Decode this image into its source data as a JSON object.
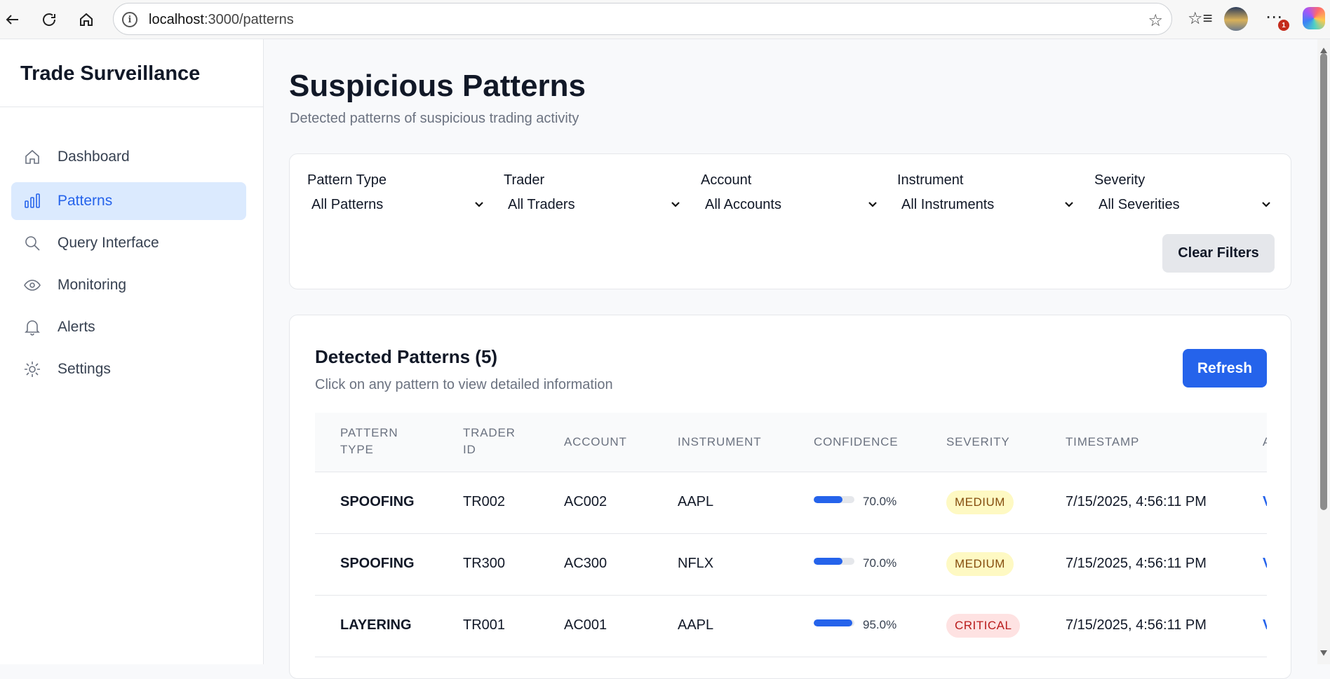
{
  "browser": {
    "url_host": "localhost",
    "url_path": ":3000/patterns",
    "notification_count": "1"
  },
  "sidebar": {
    "brand": "Trade Surveillance",
    "items": [
      {
        "label": "Dashboard",
        "icon": "home-icon",
        "active": false
      },
      {
        "label": "Patterns",
        "icon": "bar-chart-icon",
        "active": true
      },
      {
        "label": "Query Interface",
        "icon": "search-icon",
        "active": false
      },
      {
        "label": "Monitoring",
        "icon": "eye-icon",
        "active": false
      },
      {
        "label": "Alerts",
        "icon": "bell-icon",
        "active": false
      },
      {
        "label": "Settings",
        "icon": "gear-icon",
        "active": false
      }
    ]
  },
  "header": {
    "title": "Suspicious Patterns",
    "subtitle": "Detected patterns of suspicious trading activity"
  },
  "filters": {
    "pattern_type": {
      "label": "Pattern Type",
      "value": "All Patterns"
    },
    "trader": {
      "label": "Trader",
      "value": "All Traders"
    },
    "account": {
      "label": "Account",
      "value": "All Accounts"
    },
    "instrument": {
      "label": "Instrument",
      "value": "All Instruments"
    },
    "severity": {
      "label": "Severity",
      "value": "All Severities"
    },
    "clear_label": "Clear Filters"
  },
  "patterns": {
    "title": "Detected Patterns (5)",
    "subtitle": "Click on any pattern to view detailed information",
    "refresh_label": "Refresh",
    "columns": {
      "pattern_type_1": "PATTERN",
      "pattern_type_2": "TYPE",
      "trader_id_1": "TRADER",
      "trader_id_2": "ID",
      "account": "ACCOUNT",
      "instrument": "INSTRUMENT",
      "confidence": "CONFIDENCE",
      "severity": "SEVERITY",
      "timestamp": "TIMESTAMP",
      "actions_cut": "A"
    },
    "rows": [
      {
        "pattern_type": "SPOOFING",
        "trader_id": "TR002",
        "account": "AC002",
        "instrument": "AAPL",
        "confidence": 0.7,
        "confidence_text": "70.0%",
        "severity": "MEDIUM",
        "timestamp": "7/15/2025, 4:56:11 PM",
        "action_cut": "V"
      },
      {
        "pattern_type": "SPOOFING",
        "trader_id": "TR300",
        "account": "AC300",
        "instrument": "NFLX",
        "confidence": 0.7,
        "confidence_text": "70.0%",
        "severity": "MEDIUM",
        "timestamp": "7/15/2025, 4:56:11 PM",
        "action_cut": "V"
      },
      {
        "pattern_type": "LAYERING",
        "trader_id": "TR001",
        "account": "AC001",
        "instrument": "AAPL",
        "confidence": 0.95,
        "confidence_text": "95.0%",
        "severity": "CRITICAL",
        "timestamp": "7/15/2025, 4:56:11 PM",
        "action_cut": "V"
      }
    ]
  },
  "colors": {
    "accent": "#2563eb",
    "active_nav_bg": "#dbeafe",
    "medium_bg": "#fef9c3",
    "critical_bg": "#fee2e2"
  }
}
